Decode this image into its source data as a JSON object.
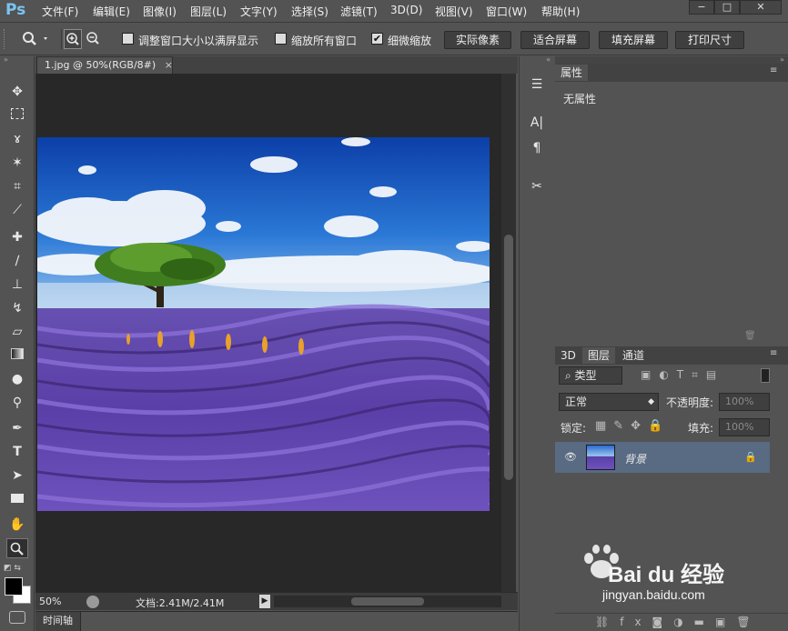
{
  "app": {
    "logo": "Ps",
    "accent": "#7ac4f2"
  },
  "menu": [
    "文件(F)",
    "编辑(E)",
    "图像(I)",
    "图层(L)",
    "文字(Y)",
    "选择(S)",
    "滤镜(T)",
    "3D(D)",
    "视图(V)",
    "窗口(W)",
    "帮助(H)"
  ],
  "window_controls": {
    "minimize": "−",
    "maximize": "□",
    "close": "✕"
  },
  "options": {
    "resize_windows_label": "调整窗口大小以满屏显示",
    "resize_windows_checked": false,
    "zoom_all_label": "缩放所有窗口",
    "zoom_all_checked": false,
    "scrubby_label": "细微缩放",
    "scrubby_checked": true,
    "actual_pixels": "实际像素",
    "fit_screen": "适合屏幕",
    "fill_screen": "填充屏幕",
    "print_size": "打印尺寸"
  },
  "document": {
    "tab_title": "1.jpg @ 50%(RGB/8#)",
    "tab_close": "×",
    "zoom": "50%",
    "doc_size": "文档:2.41M/2.41M"
  },
  "timeline": {
    "label": "时间轴"
  },
  "properties": {
    "tab": "属性",
    "empty_text": "无属性"
  },
  "layers_panel": {
    "tabs": [
      "3D",
      "图层",
      "通道"
    ],
    "filter_kind": "类型",
    "blend_mode": "正常",
    "opacity_label": "不透明度:",
    "opacity_value": "100%",
    "lock_label": "锁定:",
    "fill_label": "填充:",
    "fill_value": "100%",
    "layers": [
      {
        "name": "背景",
        "visible": true,
        "locked": true
      }
    ]
  },
  "watermark": {
    "brand": "Bai du 经验",
    "url": "jingyan.baidu.com"
  }
}
